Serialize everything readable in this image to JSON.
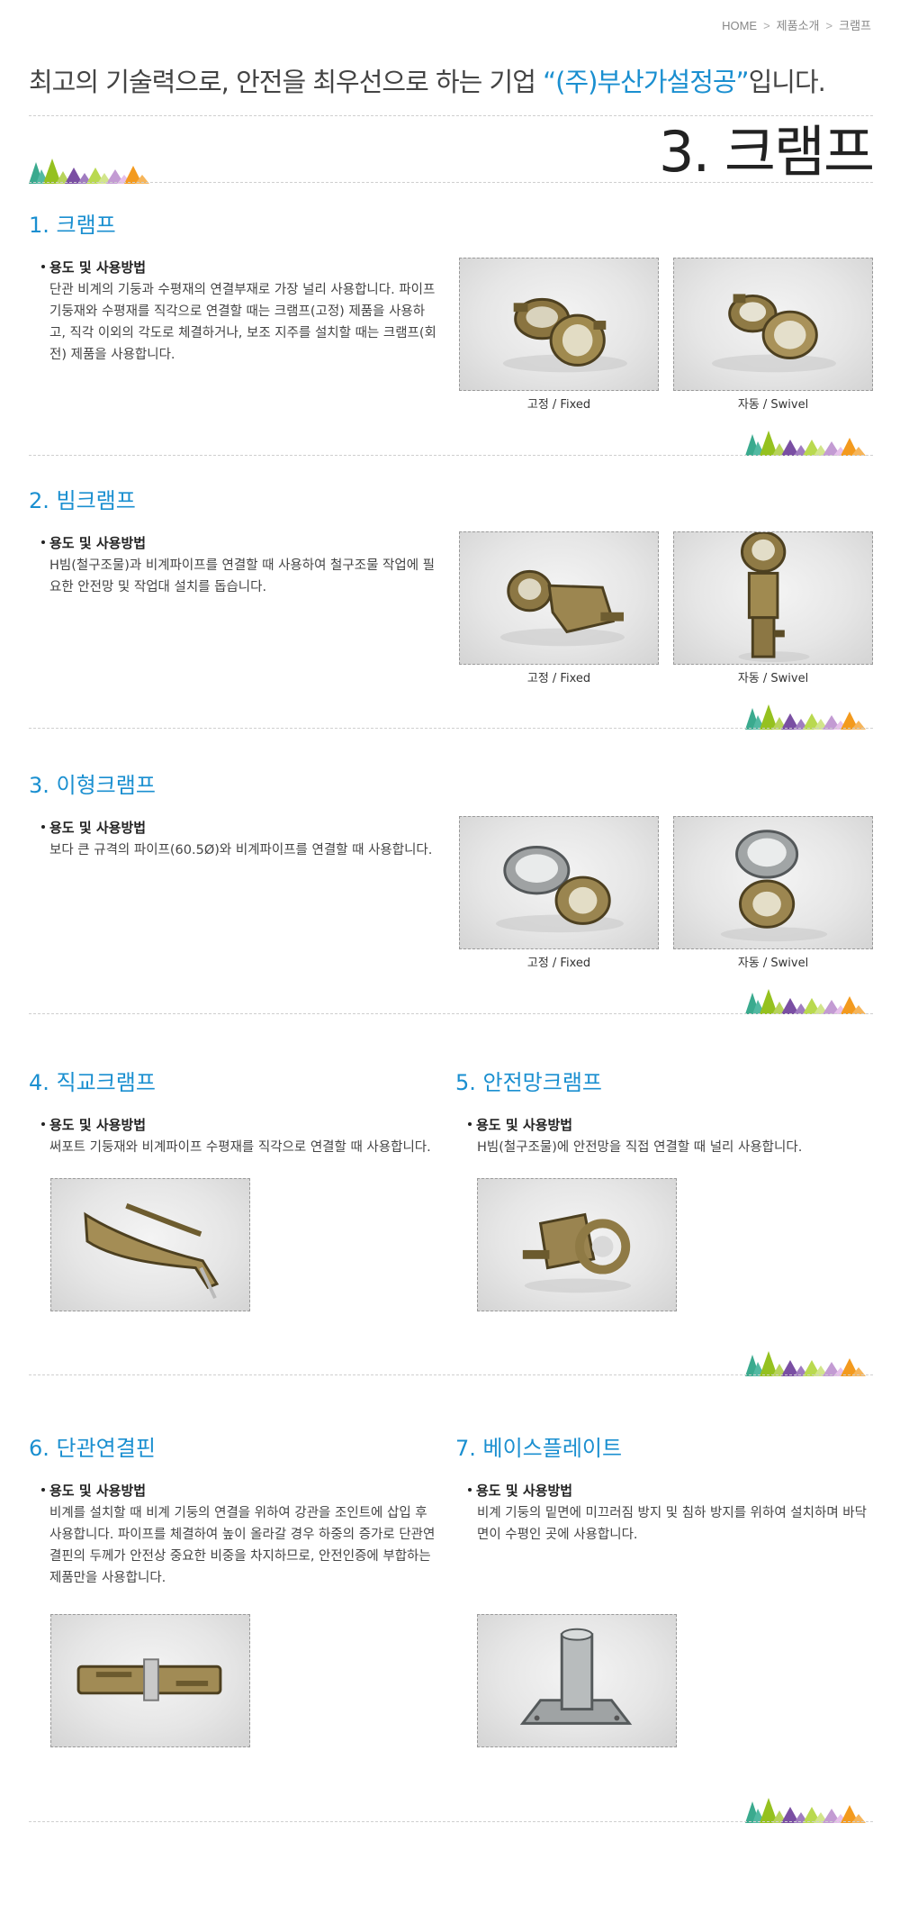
{
  "breadcrumb": {
    "home": "HOME",
    "product_intro": "제품소개",
    "current": "크램프"
  },
  "tagline": {
    "prefix": "최고의 기술력으로, 안전을 최우선으로 하는 기업 ",
    "brand": "“(주)부산가설정공”",
    "suffix": "입니다."
  },
  "page_title": "3. 크램프",
  "usage_heading": "용도 및 사용방법",
  "captions": {
    "fixed": "고정 / Fixed",
    "swivel": "자동 / Swivel"
  },
  "sections": [
    {
      "title": "1. 크램프",
      "text": "단관 비계의 기둥과 수평재의 연결부재로 가장 널리 사용합니다. 파이프 기둥재와 수평재를 직각으로 연결할 때는 크램프(고정) 제품을 사용하고, 직각 이외의 각도로 체결하거나, 보조 지주를 설치할 때는 크램프(회전) 제품을 사용합니다."
    },
    {
      "title": "2. 빔크램프",
      "text": "H빔(철구조물)과 비계파이프를 연결할 때 사용하여 철구조물 작업에 필요한 안전망 및 작업대 설치를 돕습니다."
    },
    {
      "title": "3. 이형크램프",
      "text": "보다 큰 규격의 파이프(60.5Ø)와 비계파이프를 연결할 때 사용합니다."
    },
    {
      "title": "4. 직교크램프",
      "text": "써포트 기둥재와 비계파이프 수평재를 직각으로 연결할 때 사용합니다."
    },
    {
      "title": "5. 안전망크램프",
      "text": "H빔(철구조물)에 안전망을 직접 연결할 때 널리 사용합니다."
    },
    {
      "title": "6. 단관연결핀",
      "text": "비계를 설치할 때 비계 기둥의 연결을 위하여 강관을 조인트에 삽입 후 사용합니다. 파이프를 체결하여 높이 올라갈 경우 하중의 증가로 단관연결핀의 두께가 안전상 중요한 비중을 차지하므로, 안전인증에 부합하는 제품만을 사용합니다."
    },
    {
      "title": "7. 베이스플레이트",
      "text": "비계 기둥의 밑면에 미끄러짐 방지 및 침하 방지를 위하여 설치하며 바닥 면이 수평인 곳에 사용합니다."
    }
  ]
}
